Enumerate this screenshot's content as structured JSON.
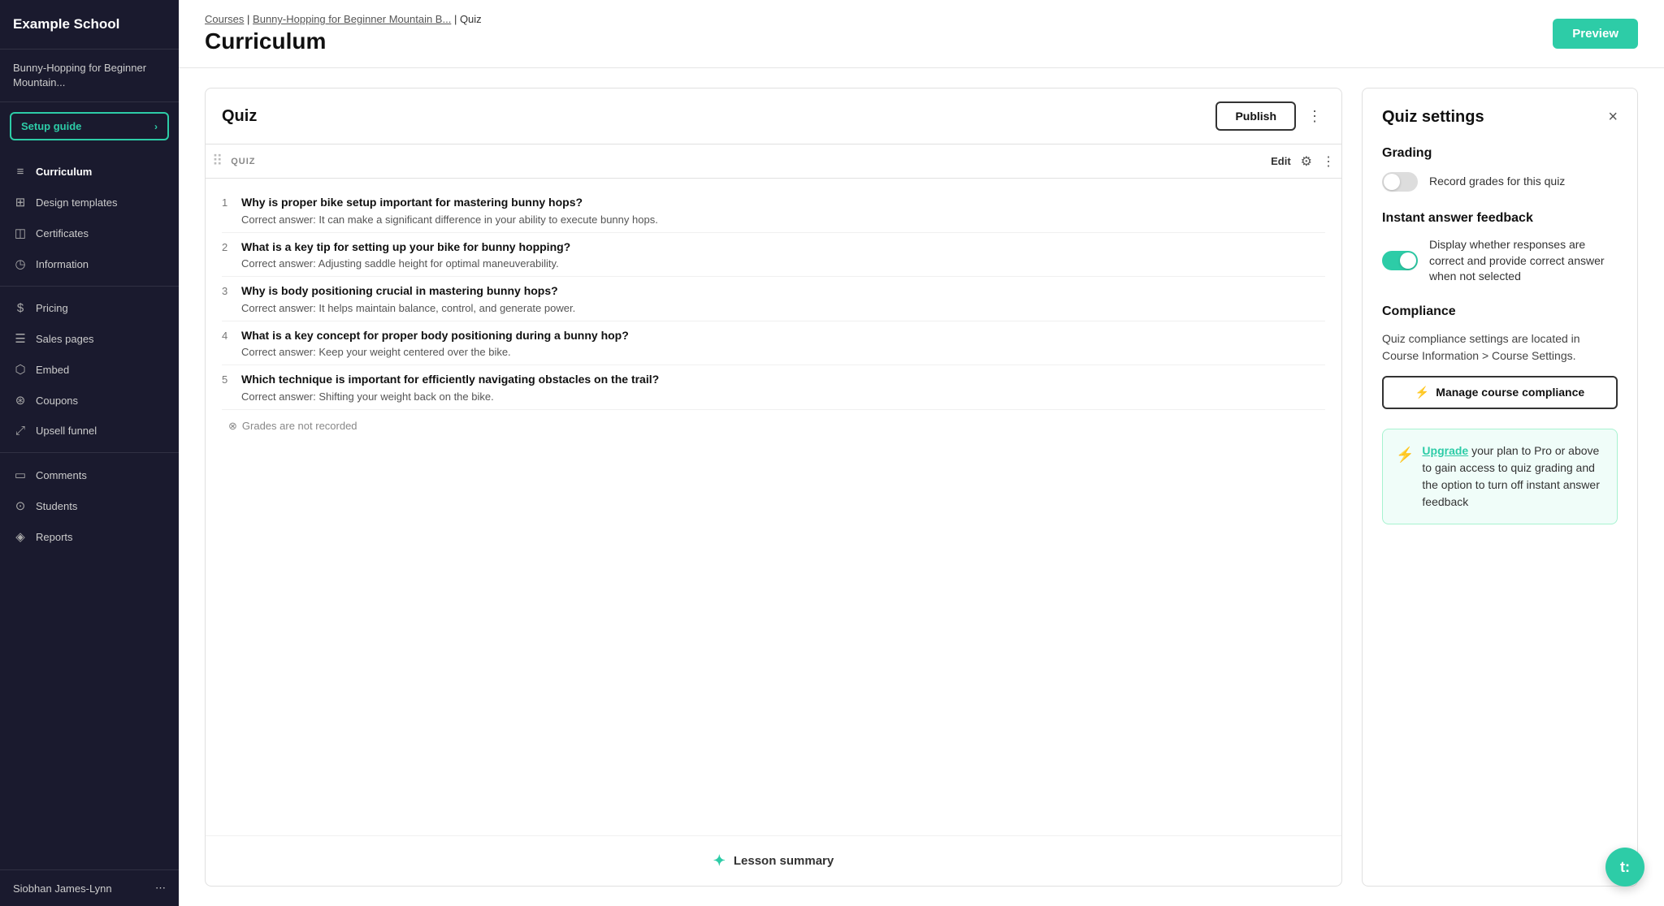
{
  "school": {
    "name": "Example School"
  },
  "course": {
    "title": "Bunny-Hopping for Beginner Mountain..."
  },
  "sidebar": {
    "setup_guide_label": "Setup guide",
    "items": [
      {
        "id": "curriculum",
        "label": "Curriculum",
        "icon": "📄",
        "active": true
      },
      {
        "id": "design-templates",
        "label": "Design templates",
        "icon": "🎨"
      },
      {
        "id": "certificates",
        "label": "Certificates",
        "icon": "🏅"
      },
      {
        "id": "information",
        "label": "Information",
        "icon": "ℹ️"
      },
      {
        "id": "pricing",
        "label": "Pricing",
        "icon": "💲"
      },
      {
        "id": "sales-pages",
        "label": "Sales pages",
        "icon": "📝"
      },
      {
        "id": "embed",
        "label": "Embed",
        "icon": "🔗"
      },
      {
        "id": "coupons",
        "label": "Coupons",
        "icon": "🏷️"
      },
      {
        "id": "upsell-funnel",
        "label": "Upsell funnel",
        "icon": "🔀"
      },
      {
        "id": "comments",
        "label": "Comments",
        "icon": "💬"
      },
      {
        "id": "students",
        "label": "Students",
        "icon": "👥"
      },
      {
        "id": "reports",
        "label": "Reports",
        "icon": "📊"
      }
    ],
    "footer": {
      "user": "Siobhan James-Lynn"
    }
  },
  "header": {
    "breadcrumb": {
      "courses": "Courses",
      "course": "Bunny-Hopping for Beginner Mountain B...",
      "current": "Quiz"
    },
    "page_title": "Curriculum",
    "preview_btn": "Preview"
  },
  "quiz": {
    "title": "Quiz",
    "publish_btn": "Publish",
    "section_label": "QUIZ",
    "edit_label": "Edit",
    "questions": [
      {
        "num": "1",
        "text": "Why is proper bike setup important for mastering bunny hops?",
        "answer": "Correct answer: It can make a significant difference in your ability to execute bunny hops."
      },
      {
        "num": "2",
        "text": "What is a key tip for setting up your bike for bunny hopping?",
        "answer": "Correct answer: Adjusting saddle height for optimal maneuverability."
      },
      {
        "num": "3",
        "text": "Why is body positioning crucial in mastering bunny hops?",
        "answer": "Correct answer: It helps maintain balance, control, and generate power."
      },
      {
        "num": "4",
        "text": "What is a key concept for proper body positioning during a bunny hop?",
        "answer": "Correct answer: Keep your weight centered over the bike."
      },
      {
        "num": "5",
        "text": "Which technique is important for efficiently navigating obstacles on the trail?",
        "answer": "Correct answer: Shifting your weight back on the bike."
      }
    ],
    "grades_notice": "Grades are not recorded",
    "lesson_summary": "Lesson summary"
  },
  "settings": {
    "title": "Quiz settings",
    "grading": {
      "section_title": "Grading",
      "toggle_label": "Record grades for this quiz",
      "enabled": false
    },
    "instant_feedback": {
      "section_title": "Instant answer feedback",
      "toggle_label": "Display whether responses are correct and provide correct answer when not selected",
      "enabled": true
    },
    "compliance": {
      "section_title": "Compliance",
      "description": "Quiz compliance settings are located in Course Information > Course Settings.",
      "manage_btn": "Manage course compliance"
    },
    "upgrade": {
      "link_text": "Upgrade",
      "description": " your plan to Pro or above to gain access to quiz grading and the option to turn off instant answer feedback"
    }
  },
  "fab": {
    "label": "t:"
  }
}
